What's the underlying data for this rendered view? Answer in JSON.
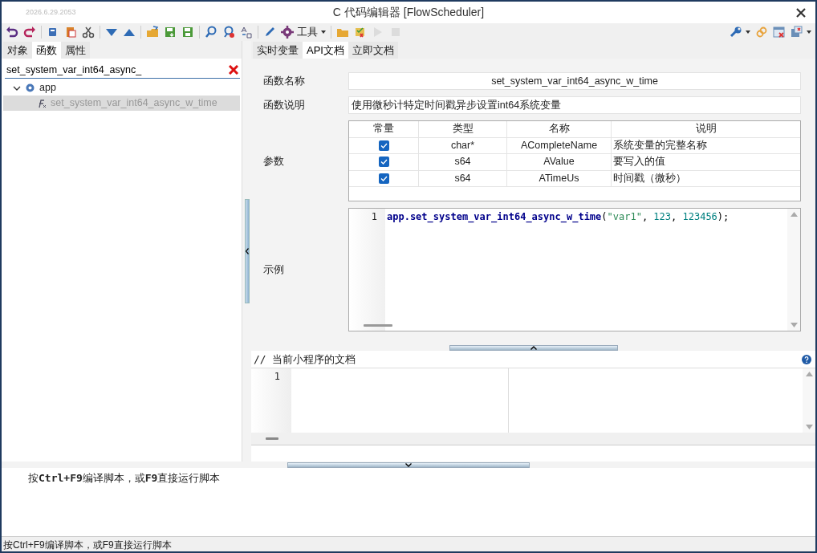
{
  "window": {
    "version": "2026.6.29.2053",
    "title": "C 代码编辑器 [FlowScheduler]"
  },
  "toolbar": {
    "tools_menu": "工具",
    "run": {
      "disabled": true
    },
    "stop": {
      "disabled": true
    }
  },
  "left_panel": {
    "tabs": [
      {
        "label": "对象",
        "selected": false
      },
      {
        "label": "函数",
        "selected": true
      },
      {
        "label": "属性",
        "selected": false
      }
    ],
    "search": {
      "value": "set_system_var_int64_async_"
    },
    "tree": [
      {
        "label": "app",
        "expanded": true,
        "selected": false,
        "children": [
          {
            "label": "set_system_var_int64_async_w_time",
            "selected": true
          }
        ]
      }
    ]
  },
  "right_panel": {
    "tabs": [
      {
        "label": "实时变量",
        "selected": false
      },
      {
        "label": "API文档",
        "selected": true
      },
      {
        "label": "立即文档",
        "selected": false
      }
    ],
    "function_name": {
      "label": "函数名称",
      "value": "set_system_var_int64_async_w_time"
    },
    "function_desc": {
      "label": "函数说明",
      "value": "使用微秒计特定时间戳异步设置int64系统变量"
    },
    "params": {
      "label": "参数",
      "columns": [
        "常量",
        "类型",
        "名称",
        "说明"
      ],
      "rows": [
        {
          "checked": true,
          "type": "char*",
          "name": "ACompleteName",
          "desc": "系统变量的完整名称"
        },
        {
          "checked": true,
          "type": "s64",
          "name": "AValue",
          "desc": "要写入的值"
        },
        {
          "checked": true,
          "type": "s64",
          "name": "ATimeUs",
          "desc": "时间戳（微秒）"
        }
      ]
    },
    "example": {
      "label": "示例",
      "line_number": "1",
      "tokens": [
        {
          "kind": "ident",
          "text": "app.set_system_var_int64_async_w_time"
        },
        {
          "kind": "punct",
          "text": "("
        },
        {
          "kind": "string",
          "text": "\"var1\""
        },
        {
          "kind": "punct",
          "text": ", "
        },
        {
          "kind": "number",
          "text": "123"
        },
        {
          "kind": "punct",
          "text": ", "
        },
        {
          "kind": "number",
          "text": "123456"
        },
        {
          "kind": "punct",
          "text": ");"
        }
      ]
    },
    "doc_editor": {
      "header": "// 当前小程序的文档",
      "line_number": "1"
    }
  },
  "message": "按**Ctrl+F9**编译脚本，或**F9**直接运行脚本",
  "status_bar": "按Ctrl+F9编译脚本，或F9直接运行脚本"
}
